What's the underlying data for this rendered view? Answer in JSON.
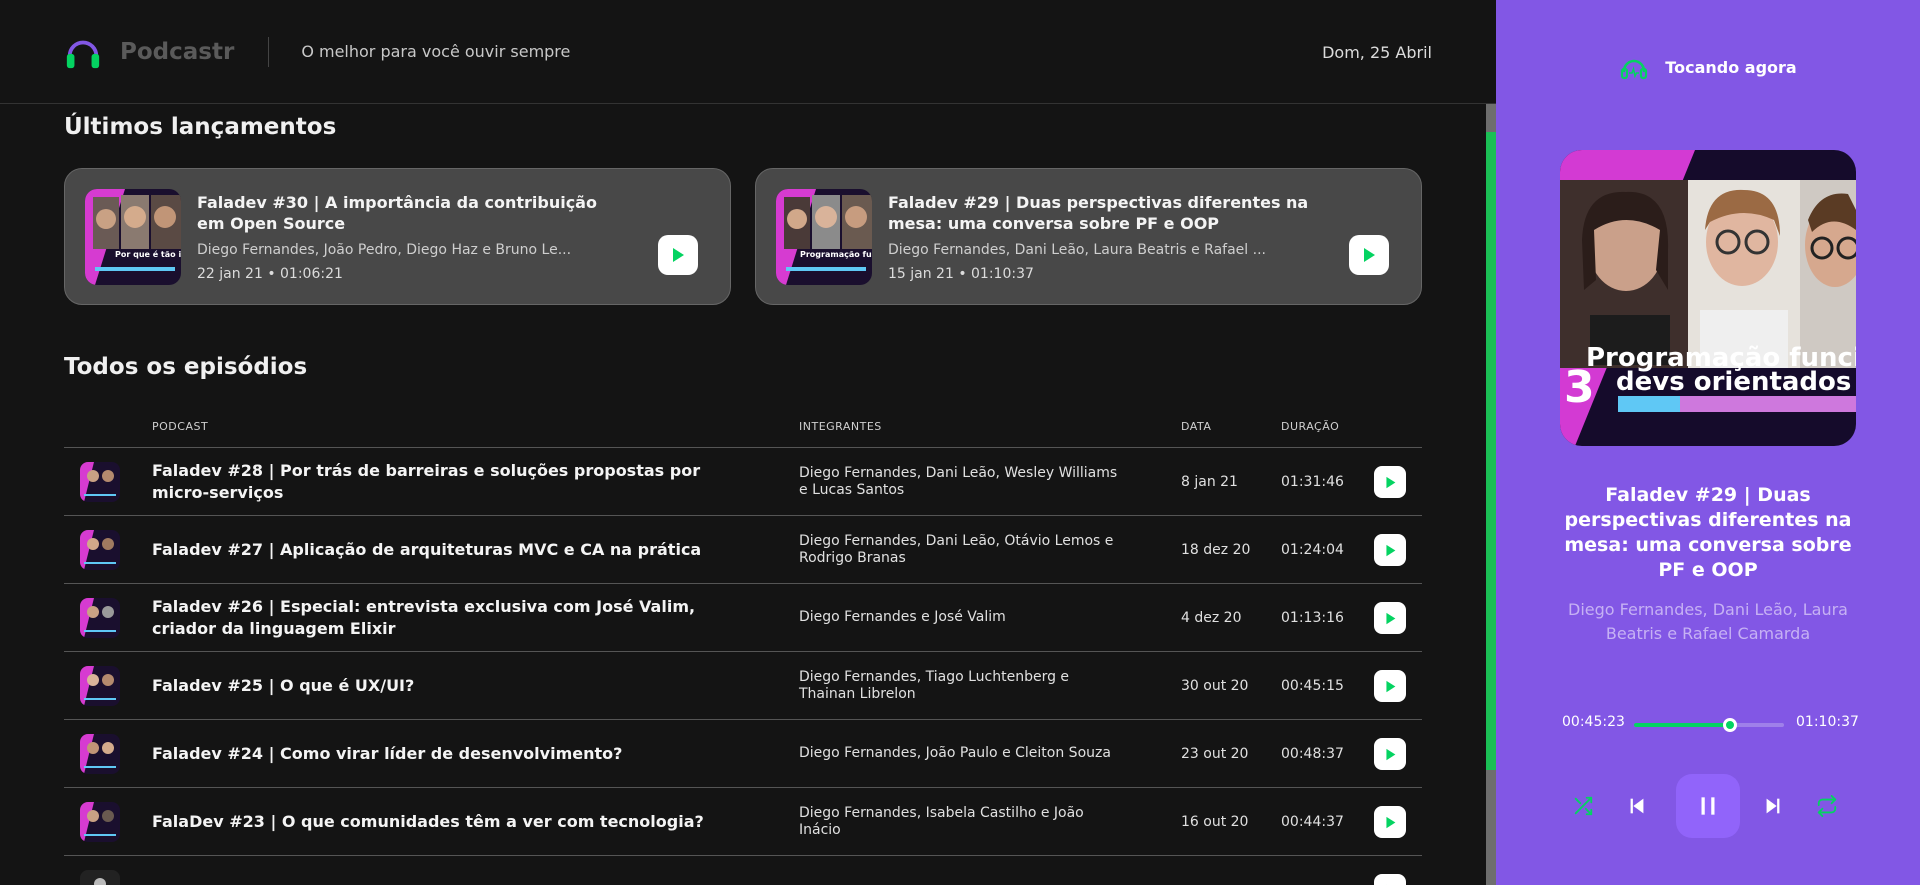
{
  "header": {
    "app_name": "Podcastr",
    "tagline": "O melhor para você ouvir sempre",
    "date": "Dom, 25 Abril"
  },
  "latest": {
    "title": "Últimos lançamentos",
    "episodes": [
      {
        "title": "Faladev #30 | A importância da contribuição em Open Source",
        "members": "Diego Fernandes, João Pedro, Diego Haz e Bruno Le...",
        "meta": "22 jan 21 • 01:06:21",
        "thumb_caption": "Por que é tão imp contribuir em Open S"
      },
      {
        "title": "Faladev #29 | Duas perspectivas diferentes na mesa: uma conversa sobre PF e OOP",
        "members": "Diego Fernandes, Dani Leão, Laura Beatris e Rafael ...",
        "meta": "15 jan 21 • 01:10:37",
        "thumb_caption": "Programação funcion devs orientados a o"
      }
    ]
  },
  "all": {
    "title": "Todos os episódios",
    "columns": [
      "PODCAST",
      "INTEGRANTES",
      "DATA",
      "DURAÇÃO"
    ],
    "rows": [
      {
        "title": "Faladev #28 | Por trás de barreiras e soluções propostas por micro-serviços",
        "members": "Diego Fernandes, Dani Leão, Wesley Williams e Lucas Santos",
        "date": "8 jan 21",
        "duration": "01:31:46"
      },
      {
        "title": "Faladev #27 | Aplicação de arquiteturas MVC e CA na prática",
        "members": "Diego Fernandes, Dani Leão, Otávio Lemos e Rodrigo Branas",
        "date": "18 dez 20",
        "duration": "01:24:04"
      },
      {
        "title": "Faladev #26 | Especial: entrevista exclusiva com José Valim, criador da linguagem Elixir",
        "members": "Diego Fernandes e José Valim",
        "date": "4 dez 20",
        "duration": "01:13:16"
      },
      {
        "title": "Faladev #25 | O que é UX/UI?",
        "members": "Diego Fernandes, Tiago Luchtenberg e Thainan Librelon",
        "date": "30 out 20",
        "duration": "00:45:15"
      },
      {
        "title": "Faladev #24 | Como virar líder de desenvolvimento?",
        "members": "Diego Fernandes, João Paulo e Cleiton Souza",
        "date": "23 out 20",
        "duration": "00:48:37"
      },
      {
        "title": "FalaDev #23 | O que comunidades têm a ver com tecnologia?",
        "members": "Diego Fernandes, Isabela Castilho e João Inácio",
        "date": "16 out 20",
        "duration": "00:44:37"
      }
    ]
  },
  "player": {
    "now_playing_label": "Tocando agora",
    "title": "Faladev #29 | Duas perspectivas diferentes na mesa: uma conversa sobre PF e OOP",
    "members": "Diego Fernandes, Dani Leão, Laura Beatris e Rafael Camarda",
    "cover_caption_line1": "Programação funcion",
    "cover_caption_line2": "devs orientados a o",
    "cover_number": "3",
    "current_time": "00:45:23",
    "total_time": "01:10:37",
    "progress": 0.643
  },
  "colors": {
    "accent_green": "#04d361",
    "player_purple": "#8257e5"
  },
  "icons": {
    "play": "play-icon",
    "shuffle": "shuffle-icon",
    "previous": "previous-icon",
    "pause": "pause-icon",
    "next": "next-icon",
    "repeat": "repeat-icon",
    "logo": "headphones-icon"
  }
}
